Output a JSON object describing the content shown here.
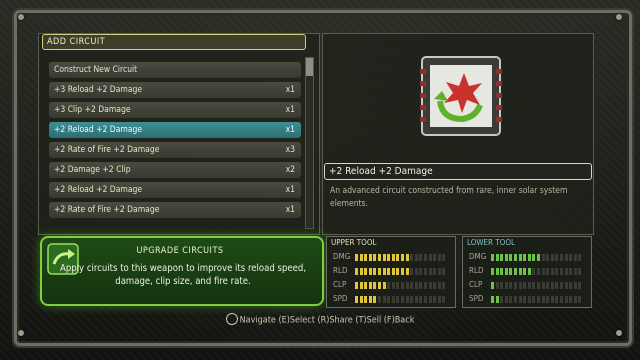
{
  "header": {
    "title": "ADD CIRCUIT"
  },
  "circuits": [
    {
      "label": "Construct New Circuit",
      "qty": ""
    },
    {
      "label": "+3 Reload  +2 Damage",
      "qty": "x1"
    },
    {
      "label": "+3 Clip  +2 Damage",
      "qty": "x1"
    },
    {
      "label": "+2 Reload  +2 Damage",
      "qty": "x1",
      "selected": true
    },
    {
      "label": "+2 Rate of Fire  +2 Damage",
      "qty": "x3"
    },
    {
      "label": "+2 Damage  +2 Clip",
      "qty": "x2"
    },
    {
      "label": "+2 Reload  +2 Damage",
      "qty": "x1"
    },
    {
      "label": "+2 Rate of Fire  +2 Damage",
      "qty": "x1"
    }
  ],
  "tip": {
    "title": "UPGRADE CIRCUITS",
    "body": "Apply circuits to this weapon to improve its reload speed, damage, clip size, and fire rate."
  },
  "detail": {
    "name": "+2 Reload  +2 Damage",
    "description": "An advanced circuit constructed from rare, inner solar system elements."
  },
  "upper_tool": {
    "title": "UPPER TOOL",
    "stats": [
      {
        "label": "DMG",
        "level": 0.6
      },
      {
        "label": "RLD",
        "level": 0.6
      },
      {
        "label": "CLP",
        "level": 0.35
      },
      {
        "label": "SPD",
        "level": 0.25
      }
    ]
  },
  "lower_tool": {
    "title": "LOWER TOOL",
    "stats": [
      {
        "label": "DMG",
        "level": 0.55
      },
      {
        "label": "RLD",
        "level": 0.45
      },
      {
        "label": "CLP",
        "level": 0.05
      },
      {
        "label": "SPD",
        "level": 0.1
      }
    ]
  },
  "footer": {
    "text": "Navigate (E)Select (R)Share (T)Sell (F)Back"
  },
  "colors": {
    "accent_green": "#7ad13b",
    "select_teal": "#3e8e93",
    "bar_yellow": "#e0c63c",
    "bar_green": "#6cc24a"
  }
}
